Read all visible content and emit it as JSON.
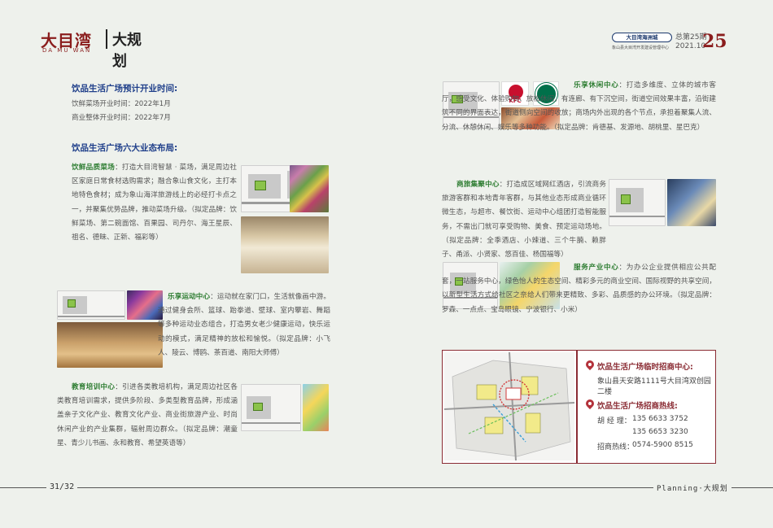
{
  "header": {
    "logo_cn": "大目湾",
    "logo_en": "DA MU WAN",
    "section": "大规划",
    "brand": "大目湾海洲城",
    "brand_sub": "象山县大目湾开发建设管理中心",
    "issue_no": "总第25期",
    "issue_date": "2021.10",
    "page_number": "25"
  },
  "opening": {
    "title": "饮品生活广场预计开业时间:",
    "lines": [
      "饮鲜菜场开业时间：2022年1月",
      "商业整体开业时间：2022年7月"
    ]
  },
  "formats_title": "饮品生活广场六大业态布局:",
  "sections": {
    "market": {
      "lead": "饮鲜品质菜场",
      "text": "：打造大目湾智慧 · 菜场，满足周边社区家庭日常食材选购需求；融合象山食文化，主打本地特色食材；成为象山海洋旅游线上的必经打卡点之一，并聚集优势品牌，推动菜场升级。（拟定品牌：饮鲜菜场、第二碗面馆、百果园、司丹尔、海王星辰、祖名、德昧、正新、福彩等）"
    },
    "sports": {
      "lead": "乐享运动中心",
      "text": "：运动就在家门口，生活就像画中游。通过健身会所、篮球、跆拳道、壁球、室内攀岩、舞蹈等多种运动业态组合，打造男女老少健康运动，快乐运动的模式，满足精神的放松和愉悦。（拟定品牌：小飞人、陵云、博鸥、茶百道、南阳大师傅）"
    },
    "education": {
      "lead": "教育培训中心",
      "text": "：引进各类教培机构，满足周边社区各类教育培训需求，提供多阶段、多类型教育品牌，形成涵盖亲子文化产业、教育文化产业、商业街旅游产业、时尚休闲产业的产业集群，辐射周边群众。（拟定品牌：潮童星、青少儿书画、永和教育、希望英语等）"
    },
    "leisure": {
      "lead": "乐享休闲中心",
      "text": "：打造多维度、立体的城市客厅，感受文化、体验购物、放松休闲，有连廊、有下沉空间，街道空间效果丰富，沿街建筑不同的界面表达，街道侧向空间的收放；商场内外出现的各个节点，承担着聚集人流、分流、休憩休闲、娱乐等多种功能。（拟定品牌：肯德基、发源地、胡桃里、星巴克）"
    },
    "business": {
      "lead": "商旅集聚中心",
      "text": "：打造成区域网红酒店，引流商务旅游客群和本地青年客群，与其他业态形成商业循环微生态，与超市、餐饮街、运动中心组团打造智能服务，不需出门就可享受购物、美食、预定运动场地。（拟定品牌：全季酒店、小辣道、三个牛腩、赖胖子、甬派、小贤家、悠百佳、杨国福等）"
    },
    "service": {
      "lead": "服务产业中心",
      "text": "：为办公企业提供相应公共配套，一站服务中心，绿色怡人的生态空间、精彩多元的商业空间、国际视野的共享空间，以新型生活方式给社区之奈给人们带来更精致、多彩、品质感的办公环境。（拟定品牌：罗森、一点点、宝岛眼镜、宁波银行、小米）"
    }
  },
  "logos": {
    "kfc": "KFC"
  },
  "contact": {
    "office_title": "饮品生活广场临时招商中心:",
    "office_address": "象山县天安路1111号大目湾双创园二楼",
    "hotline_title": "饮品生活广场招商热线:",
    "person_label": "胡 经 理：",
    "phone1": "135 6633 3752",
    "phone2": "135 6653 3230",
    "hotline_label": "招商热线：",
    "hotline_number": "0574-5900 8515"
  },
  "footer": {
    "page_left": "31/32",
    "page_right": "Planning·大规划"
  }
}
